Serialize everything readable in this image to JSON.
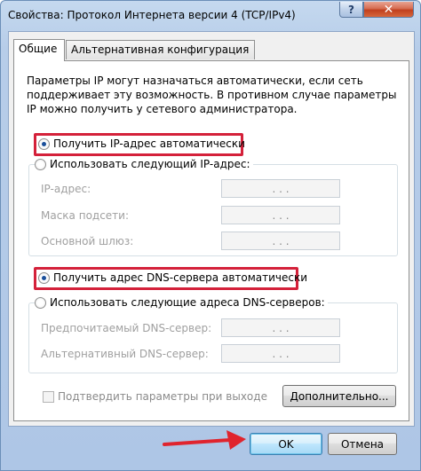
{
  "window": {
    "title": "Свойства: Протокол Интернета версии 4 (TCP/IPv4)",
    "help_glyph": "?",
    "close_glyph": "✕"
  },
  "tabs": [
    {
      "label": "Общие",
      "active": true
    },
    {
      "label": "Альтернативная конфигурация",
      "active": false
    }
  ],
  "description": "Параметры IP могут назначаться автоматически, если сеть\nподдерживает эту возможность. В противном случае параметры\nIP можно получить у сетевого администратора.",
  "ip_section": {
    "auto_label": "Получить IP-адрес автоматически",
    "auto_selected": true,
    "manual_label": "Использовать следующий IP-адрес:",
    "fields": [
      {
        "label": "IP-адрес:",
        "value": ".       .       ."
      },
      {
        "label": "Маска подсети:",
        "value": ".       .       ."
      },
      {
        "label": "Основной шлюз:",
        "value": ".       .       ."
      }
    ]
  },
  "dns_section": {
    "auto_label": "Получить адрес DNS-сервера автоматически",
    "auto_selected": true,
    "manual_label": "Использовать следующие адреса DNS-серверов:",
    "fields": [
      {
        "label": "Предпочитаемый DNS-сервер:",
        "value": ".       .       ."
      },
      {
        "label": "Альтернативный DNS-сервер:",
        "value": ".       .       ."
      }
    ]
  },
  "validate_label": "Подтвердить параметры при выходе",
  "buttons": {
    "advanced": "Дополнительно...",
    "ok": "OK",
    "cancel": "Отмена"
  },
  "colors": {
    "highlight": "#d4213a",
    "arrow": "#e0242e"
  }
}
